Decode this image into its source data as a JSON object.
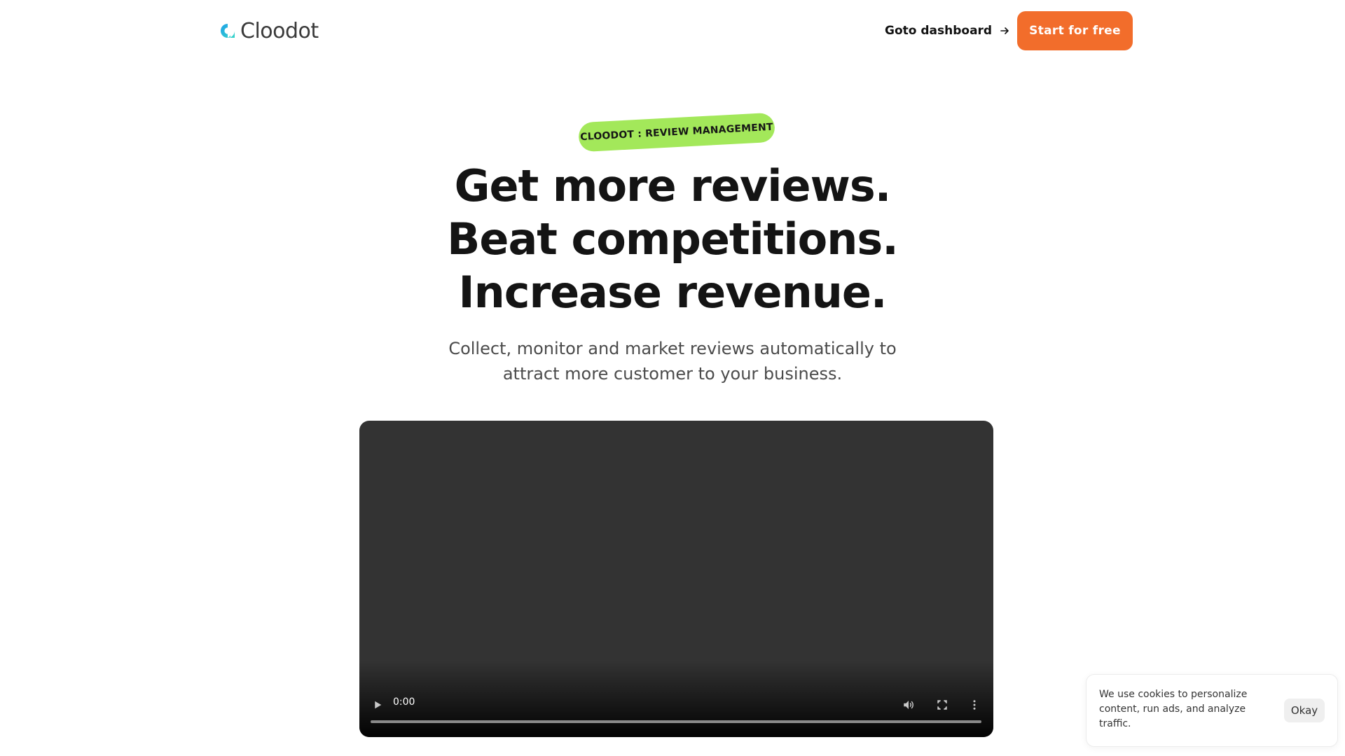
{
  "header": {
    "logo_text": "Cloodot",
    "goto_dashboard": "Goto dashboard",
    "cta": "Start for free"
  },
  "hero": {
    "badge": "CLOODOT : REVIEW MANAGEMENT",
    "headline": [
      "Get more reviews.",
      "Beat competitions.",
      "Increase revenue."
    ],
    "subline": [
      "Collect, monitor and market reviews automatically to",
      "attract more customer to your business."
    ]
  },
  "video": {
    "time": "0:00"
  },
  "cookie": {
    "text": "We use cookies to personalize content, run ads, and analyze traffic.",
    "okay": "Okay"
  },
  "colors": {
    "brand_orange": "#f26d2b",
    "badge_green": "#a3e85a",
    "logo_blue": "#1ea0e8",
    "logo_cyan": "#36d6c8"
  }
}
